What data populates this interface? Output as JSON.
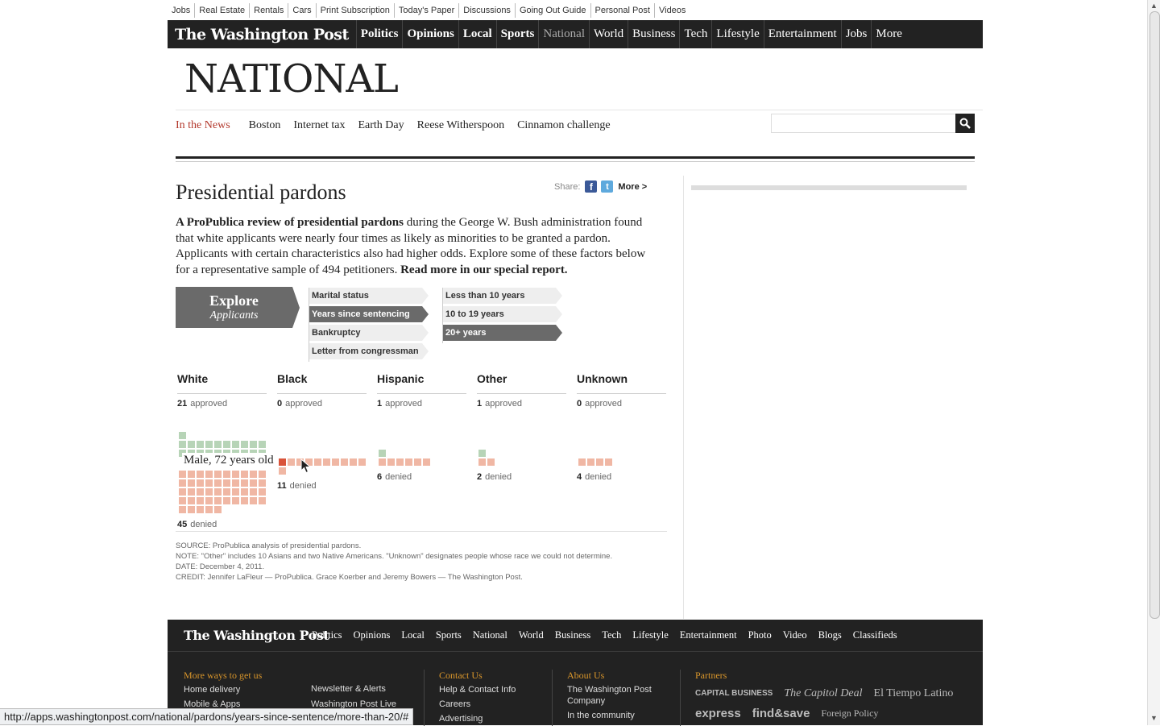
{
  "top_links": [
    "Jobs",
    "Real Estate",
    "Rentals",
    "Cars",
    "Print Subscription",
    "Today's Paper",
    "Discussions",
    "Going Out Guide",
    "Personal Post",
    "Videos"
  ],
  "header": {
    "logo_text": "The Washington Post",
    "nav": [
      {
        "label": "Politics",
        "style": "bold"
      },
      {
        "label": "Opinions",
        "style": "bold"
      },
      {
        "label": "Local",
        "style": "bold"
      },
      {
        "label": "Sports",
        "style": "bold"
      },
      {
        "label": "National",
        "style": "dim"
      },
      {
        "label": "World",
        "style": "normal"
      },
      {
        "label": "Business",
        "style": "normal"
      },
      {
        "label": "Tech",
        "style": "normal"
      },
      {
        "label": "Lifestyle",
        "style": "normal"
      },
      {
        "label": "Entertainment",
        "style": "normal"
      },
      {
        "label": "Jobs",
        "style": "normal"
      },
      {
        "label": "More",
        "style": "normal"
      }
    ]
  },
  "section_title": "NATIONAL",
  "in_the_news": {
    "label": "In the News",
    "items": [
      "Boston",
      "Internet tax",
      "Earth Day",
      "Reese Witherspoon",
      "Cinnamon challenge"
    ]
  },
  "search": {
    "placeholder": ""
  },
  "article": {
    "headline": "Presidential pardons",
    "share": {
      "label": "Share:",
      "more": "More >"
    },
    "intro_bold": "A ProPublica review of presidential pardons",
    "intro_text": " during the George W. Bush administration found that white applicants were nearly four times as likely as minorities to be granted a pardon. Applicants with certain characteristics also had higher odds. Explore some of these factors below for a representative sample of 494 petitioners. ",
    "intro_link": "Read more in our special report."
  },
  "explore": {
    "title": "Explore",
    "subtitle": "Applicants"
  },
  "factors": [
    {
      "label": "Marital status",
      "active": false
    },
    {
      "label": "Years since sentencing",
      "active": true
    },
    {
      "label": "Bankruptcy",
      "active": false
    },
    {
      "label": "Letter from congressman",
      "active": false
    }
  ],
  "options": [
    {
      "label": "Less than 10 years",
      "active": false
    },
    {
      "label": "10 to 19 years",
      "active": false
    },
    {
      "label": "20+ years",
      "active": true
    }
  ],
  "races": [
    {
      "name": "White",
      "approved": 21,
      "denied": 45
    },
    {
      "name": "Black",
      "approved": 0,
      "denied": 11
    },
    {
      "name": "Hispanic",
      "approved": 1,
      "denied": 6
    },
    {
      "name": "Other",
      "approved": 1,
      "denied": 2
    },
    {
      "name": "Unknown",
      "approved": 0,
      "denied": 4
    }
  ],
  "labels": {
    "approved": "approved",
    "denied": "denied"
  },
  "tooltip": "Male, 72 years old",
  "notes": [
    "SOURCE: ProPublica analysis of presidential pardons.",
    "NOTE: \"Other\" includes 10 Asians and two Native Americans. \"Unknown\" designates people whose race we could not determine.",
    "DATE: December 4, 2011.",
    "CREDIT: Jennifer LaFleur — ProPublica. Grace Koerber and Jeremy Bowers — The Washington Post."
  ],
  "footer": {
    "logo_text": "The Washington Post",
    "nav": [
      "Politics",
      "Opinions",
      "Local",
      "Sports",
      "National",
      "World",
      "Business",
      "Tech",
      "Lifestyle",
      "Entertainment",
      "Photo",
      "Video",
      "Blogs",
      "Classifieds"
    ],
    "more_ways": {
      "title": "More ways to get us",
      "col1": [
        "Home delivery",
        "Mobile & Apps"
      ],
      "col2": [
        "Newsletter & Alerts",
        "Washington Post Live"
      ]
    },
    "contact": {
      "title": "Contact Us",
      "items": [
        "Help & Contact Info",
        "Careers",
        "Advertising"
      ]
    },
    "about": {
      "title": "About Us",
      "items": [
        "The Washington Post Company",
        "In the community"
      ]
    },
    "partners": {
      "title": "Partners",
      "row1": [
        "CAPITAL BUSINESS",
        "The Capitol Deal",
        "El Tiempo Latino"
      ],
      "row2": [
        "express",
        "find&save",
        "Foreign Policy"
      ]
    }
  },
  "status_url": "http://apps.washingtonpost.com/national/pardons/years-since-sentence/more-than-20/#"
}
